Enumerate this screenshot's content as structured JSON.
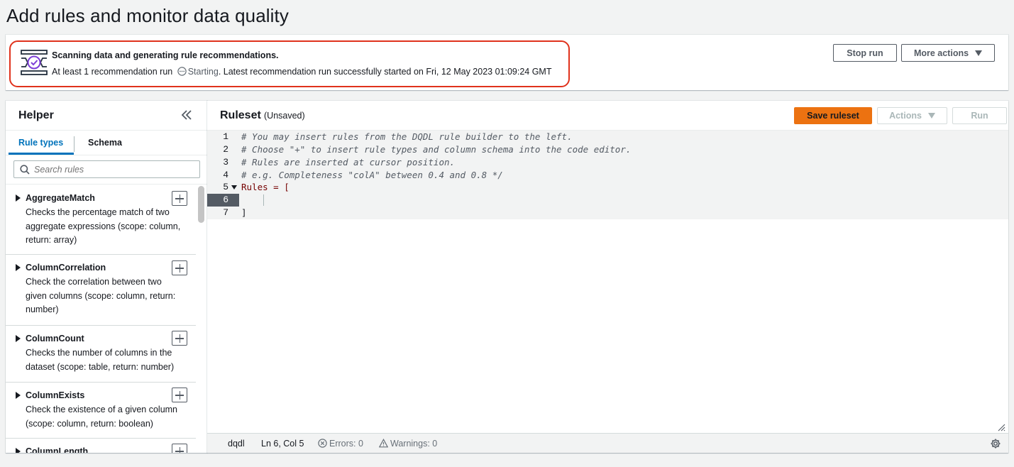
{
  "page": {
    "title": "Add rules and monitor data quality"
  },
  "flash": {
    "title": "Scanning data and generating rule recommendations.",
    "desc_prefix": "At least 1 recommendation run",
    "status": "Starting",
    "desc_suffix": ". Latest recommendation run successfully started on Fri, 12 May 2023 01:09:24 GMT",
    "accent_color": "#e0321c",
    "icon": "data-scan-check-icon"
  },
  "banner_actions": {
    "stop_run": "Stop run",
    "more_actions": "More actions"
  },
  "helper": {
    "title": "Helper",
    "tabs": [
      {
        "label": "Rule types"
      },
      {
        "label": "Schema"
      }
    ],
    "search": {
      "placeholder": "Search rules"
    },
    "rules": [
      {
        "name": "AggregateMatch",
        "description": "Checks the percentage match of two aggregate expressions (scope: column, return: array)"
      },
      {
        "name": "ColumnCorrelation",
        "description": "Check the correlation between two given columns (scope: column, return: number)"
      },
      {
        "name": "ColumnCount",
        "description": "Checks the number of columns in the dataset (scope: table, return: number)"
      },
      {
        "name": "ColumnExists",
        "description": "Check the existence of a given column (scope: column, return: boolean)"
      },
      {
        "name": "ColumnLength",
        "description": ""
      }
    ]
  },
  "ruleset": {
    "title": "Ruleset",
    "subtitle": "(Unsaved)",
    "save": "Save ruleset",
    "actions": "Actions",
    "run": "Run",
    "lines": [
      {
        "n": "1",
        "text": "# You may insert rules from the DQDL rule builder to the left."
      },
      {
        "n": "2",
        "text": "# Choose \"+\" to insert rule types and column schema into the code editor."
      },
      {
        "n": "3",
        "text": "# Rules are inserted at cursor position."
      },
      {
        "n": "4",
        "text": "# e.g. Completeness \"colA\" between 0.4 and 0.8 */"
      },
      {
        "n": "5",
        "text": "Rules = ["
      },
      {
        "n": "6",
        "text": ""
      },
      {
        "n": "7",
        "text": "]"
      }
    ]
  },
  "statusbar": {
    "language": "dqdl",
    "position": "Ln 6, Col 5",
    "errors": "Errors: 0",
    "warnings": "Warnings: 0"
  },
  "colors": {
    "primary": "#ec7211",
    "link": "#0073bb",
    "text": "#16191f"
  }
}
